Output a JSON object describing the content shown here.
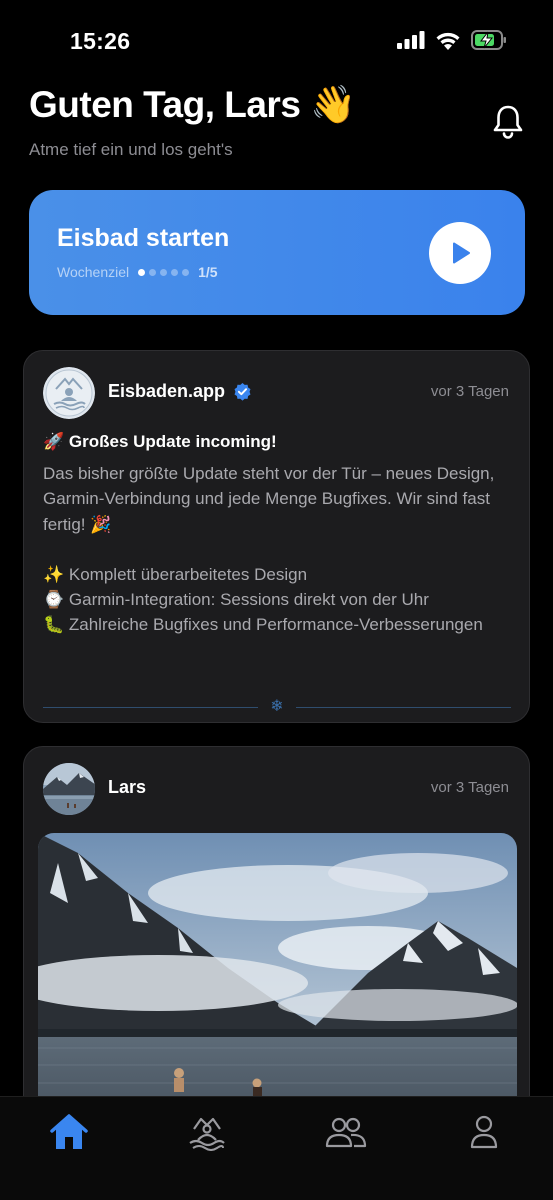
{
  "status": {
    "time": "15:26"
  },
  "header": {
    "greeting": "Guten Tag, Lars 👋",
    "subtitle": "Atme tief ein und los geht's"
  },
  "start_card": {
    "title": "Eisbad starten",
    "goal_label": "Wochenziel",
    "goal_count": "1/5",
    "goal_done": 1,
    "goal_total": 5
  },
  "feed": [
    {
      "author": "Eisbaden.app",
      "verified": true,
      "time": "vor 3 Tagen",
      "title": "🚀 Großes Update incoming!",
      "body_lines": [
        "Das bisher größte Update steht vor der Tür – neues Design, Garmin-Verbindung und jede Menge Bugfixes. Wir sind fast fertig! 🎉",
        "",
        "✨ Komplett überarbeitetes Design",
        "⌚ Garmin-Integration: Sessions direkt von der Uhr",
        "🐛 Zahlreiche Bugfixes und Performance-Verbesserungen"
      ],
      "divider_icon": "❄"
    },
    {
      "author": "Lars",
      "time": "vor 3 Tagen"
    }
  ],
  "colors": {
    "accent": "#3a82ec",
    "card_bg": "#1c1c1e",
    "muted_text": "#8d8d93",
    "tab_active": "#3a86f0"
  },
  "tabs": [
    {
      "icon": "home-icon",
      "active": true
    },
    {
      "icon": "ice-bath-icon",
      "active": false
    },
    {
      "icon": "community-icon",
      "active": false
    },
    {
      "icon": "profile-icon",
      "active": false
    }
  ]
}
